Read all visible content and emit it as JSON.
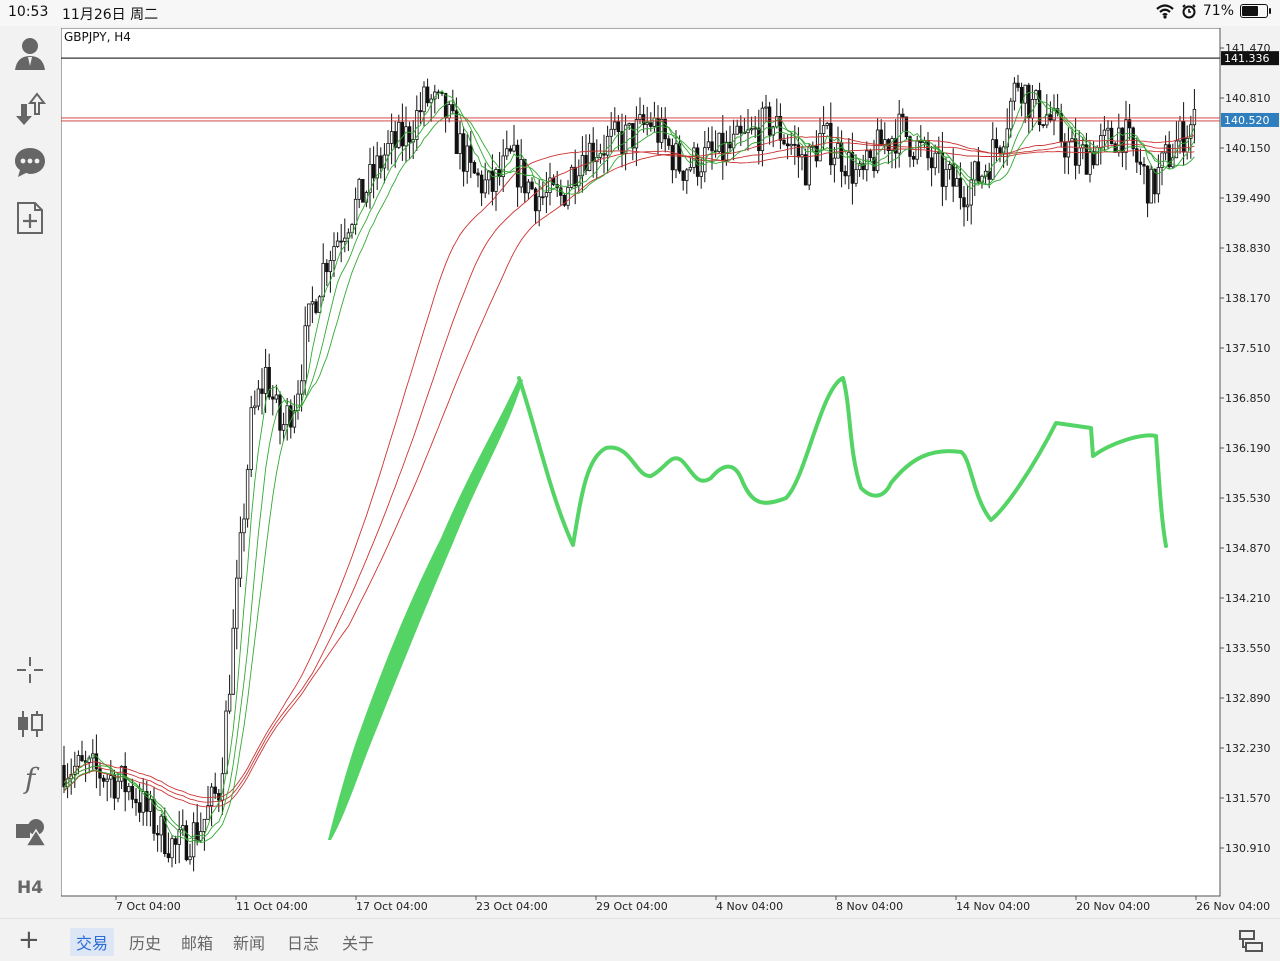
{
  "status_bar": {
    "time": "10:53",
    "date": "11月26日 周二",
    "battery": "71%",
    "battery_level": 0.71
  },
  "sidebar": {
    "tools": [
      {
        "name": "account-icon"
      },
      {
        "name": "trade-icon"
      },
      {
        "name": "chat-icon"
      },
      {
        "name": "new-document-icon"
      },
      {
        "name": "crosshair-icon"
      },
      {
        "name": "candlestick-icon"
      },
      {
        "name": "indicator-icon",
        "label": "f"
      },
      {
        "name": "objects-icon"
      },
      {
        "name": "timeframe-button",
        "label": "H4"
      }
    ]
  },
  "chart": {
    "symbol_label": "GBPJPY, H4",
    "price_labels": [
      "141.470",
      "140.810",
      "140.150",
      "139.490",
      "138.830",
      "138.170",
      "137.510",
      "136.850",
      "136.190",
      "135.530",
      "134.870",
      "134.210",
      "133.550",
      "132.890",
      "132.230",
      "131.570",
      "130.910"
    ],
    "time_labels": [
      "7 Oct 04:00",
      "11 Oct 04:00",
      "17 Oct 04:00",
      "23 Oct 04:00",
      "29 Oct 04:00",
      "4 Nov 04:00",
      "8 Nov 04:00",
      "14 Nov 04:00",
      "20 Nov 04:00",
      "26 Nov 04:00"
    ],
    "high_line": "141.336",
    "current_price": "140.520",
    "colors": {
      "green": "#33aa33",
      "red": "#cc3333",
      "drawing": "#55d466",
      "current_price_bg": "#2f7fbf",
      "high_line_bg": "#111111"
    }
  },
  "bottom_nav": {
    "tabs": [
      "交易",
      "历史",
      "邮箱",
      "新闻",
      "日志",
      "关于"
    ],
    "active_index": 0
  }
}
